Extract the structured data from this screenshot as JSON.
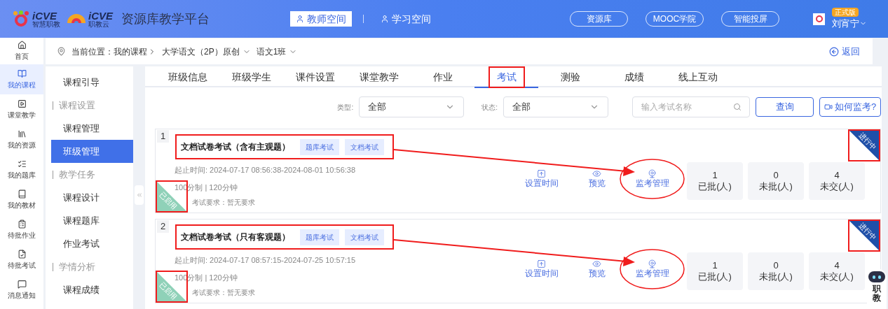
{
  "header": {
    "brands": [
      {
        "mark": "iCVE",
        "sub": "智慧职教"
      },
      {
        "mark": "iCVE",
        "sub": "职教云"
      }
    ],
    "title": "资源库教学平台",
    "spaces": [
      {
        "label": "教师空间",
        "selected": true
      },
      {
        "label": "学习空间",
        "selected": false
      }
    ],
    "links": [
      "资源库",
      "MOOC学院",
      "智能投屏"
    ],
    "user": {
      "badge": "正式版",
      "name": "刘宵宁"
    }
  },
  "rail": [
    {
      "label": "首页",
      "kind": "home",
      "selected": false
    },
    {
      "label": "我的课程",
      "kind": "course",
      "selected": true
    },
    {
      "label": "课堂教学",
      "kind": "class",
      "selected": false
    },
    {
      "label": "我的资源",
      "kind": "resource",
      "selected": false
    },
    {
      "label": "我的题库",
      "kind": "bank",
      "selected": false
    },
    {
      "label": "我的教材",
      "kind": "textbook",
      "selected": false
    },
    {
      "label": "待批作业",
      "kind": "homework",
      "selected": false
    },
    {
      "label": "待批考试",
      "kind": "exam",
      "selected": false
    },
    {
      "label": "消息通知",
      "kind": "message",
      "selected": false
    }
  ],
  "breadcrumb": {
    "label": "当前位置：",
    "path": [
      {
        "label": "我的课程",
        "dropdown": false
      },
      {
        "label": "大学语文（2P）原创",
        "dropdown": true
      },
      {
        "label": "语文1班",
        "dropdown": true
      }
    ],
    "back": "返回"
  },
  "sidebar": [
    {
      "kind": "item",
      "label": "课程引导",
      "selected": false
    },
    {
      "kind": "group",
      "label": "课程设置"
    },
    {
      "kind": "item",
      "label": "课程管理",
      "selected": false
    },
    {
      "kind": "item",
      "label": "班级管理",
      "selected": true
    },
    {
      "kind": "group",
      "label": "教学任务"
    },
    {
      "kind": "item",
      "label": "课程设计",
      "selected": false
    },
    {
      "kind": "item",
      "label": "课程题库",
      "selected": false
    },
    {
      "kind": "item",
      "label": "作业考试",
      "selected": false
    },
    {
      "kind": "group",
      "label": "学情分析"
    },
    {
      "kind": "item",
      "label": "课程成绩",
      "selected": false
    }
  ],
  "tabs": [
    {
      "label": "班级信息",
      "selected": false,
      "annotated": false
    },
    {
      "label": "班级学生",
      "selected": false,
      "annotated": false
    },
    {
      "label": "课件设置",
      "selected": false,
      "annotated": false
    },
    {
      "label": "课堂教学",
      "selected": false,
      "annotated": false
    },
    {
      "label": "作业",
      "selected": false,
      "annotated": false
    },
    {
      "label": "考试",
      "selected": true,
      "annotated": true
    },
    {
      "label": "测验",
      "selected": false,
      "annotated": false
    },
    {
      "label": "成绩",
      "selected": false,
      "annotated": false
    },
    {
      "label": "线上互动",
      "selected": false,
      "annotated": false
    }
  ],
  "filters": {
    "type_label": "类型:",
    "type_value": "全部",
    "state_label": "状态:",
    "state_value": "全部",
    "search": {
      "placeholder": "输入考试名称"
    },
    "query": "查询",
    "help": "如何监考?"
  },
  "exams": [
    {
      "number": "1",
      "title": "文档试卷考试（含有主观题）",
      "tags": [
        "题库考试",
        "文档考试"
      ],
      "time": "起止时间: 2024-07-17 08:56:38-2024-08-01 10:56:38",
      "meta": "100分制 | 120分钟",
      "requirement": "考试要求：暂无要求",
      "enabled": "已启用",
      "status": "进行中",
      "annotated": true,
      "actions": [
        {
          "kind": "time",
          "label": "设置时间",
          "annotated": false
        },
        {
          "kind": "preview",
          "label": "预览",
          "annotated": false
        },
        {
          "kind": "proctor",
          "label": "监考管理",
          "annotated": true
        }
      ],
      "stats": [
        {
          "value": "1",
          "label": "已批(人)"
        },
        {
          "value": "0",
          "label": "未批(人)"
        },
        {
          "value": "4",
          "label": "未交(人)"
        }
      ]
    },
    {
      "number": "2",
      "title": "文档试卷考试（只有客观题）",
      "tags": [
        "题库考试",
        "文档考试"
      ],
      "time": "起止时间: 2024-07-17 08:57:15-2024-07-25 10:57:15",
      "meta": "100分制 | 120分钟",
      "requirement": "考试要求：暂无要求",
      "enabled": "已启用",
      "status": "进行中",
      "annotated": true,
      "actions": [
        {
          "kind": "time",
          "label": "设置时间",
          "annotated": false
        },
        {
          "kind": "preview",
          "label": "预览",
          "annotated": false
        },
        {
          "kind": "proctor",
          "label": "监考管理",
          "annotated": true
        }
      ],
      "stats": [
        {
          "value": "1",
          "label": "已批(人)"
        },
        {
          "value": "0",
          "label": "未批(人)"
        },
        {
          "value": "4",
          "label": "未交(人)"
        }
      ]
    }
  ],
  "assistant": {
    "label": "职教"
  }
}
